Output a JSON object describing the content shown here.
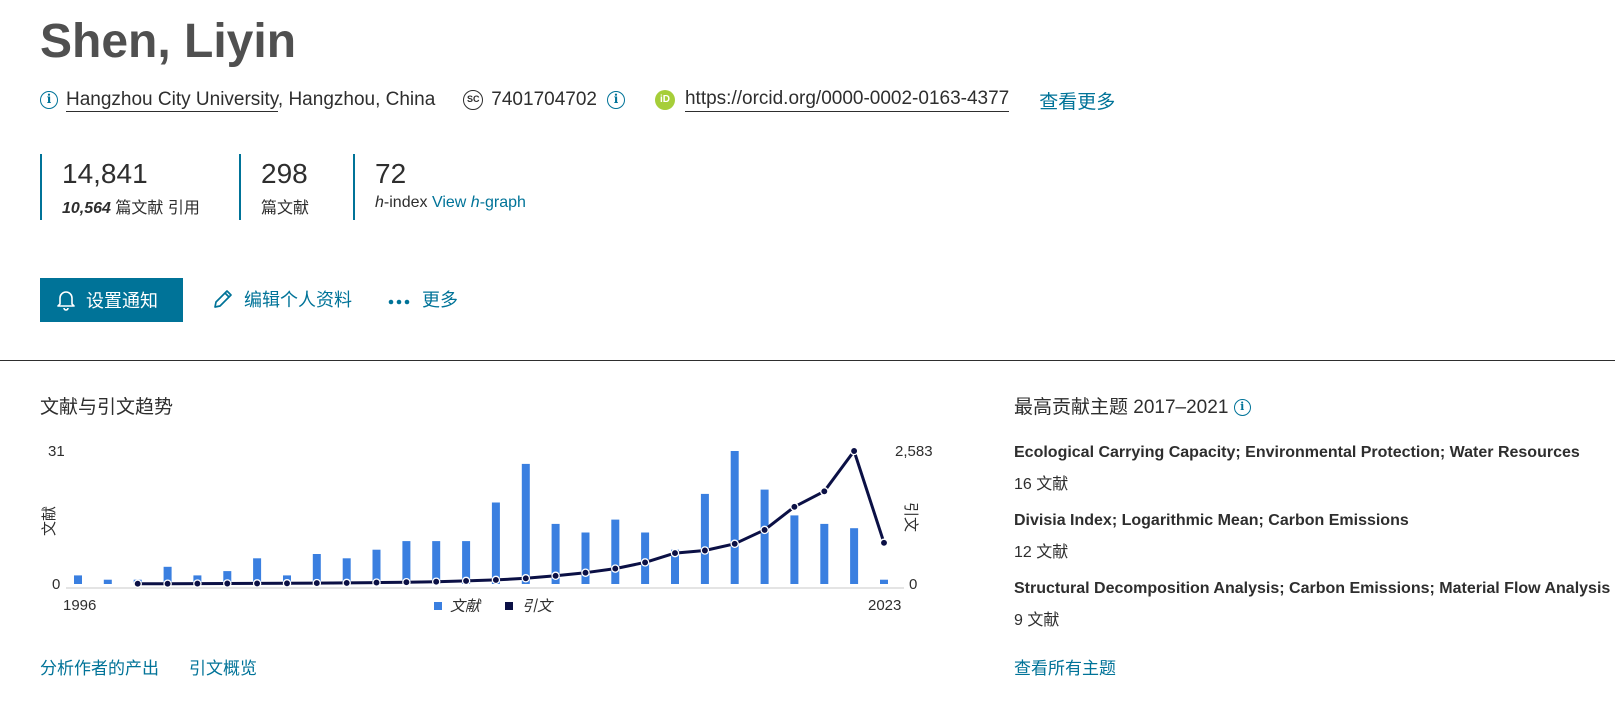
{
  "author": {
    "name": "Shen, Liyin",
    "affiliation_link": "Hangzhou City University",
    "affiliation_rest": ", Hangzhou, China",
    "scopus_id": "7401704702",
    "orcid_url": "https://orcid.org/0000-0002-0163-4377",
    "more_label": "查看更多"
  },
  "metrics": {
    "citations": {
      "value": "14,841",
      "docs_count": "10,564",
      "label_suffix": " 篇文献 引用"
    },
    "documents": {
      "value": "298",
      "label": "篇文献"
    },
    "h_index": {
      "value": "72",
      "h": "h",
      "label": "-index",
      "link_text": "View ",
      "link_h": "h",
      "link_rest": "-graph"
    }
  },
  "actions": {
    "set_alert": "设置通知",
    "edit_profile": "编辑个人资料",
    "more": "更多"
  },
  "trends": {
    "title": "文献与引文趋势",
    "left_axis_label": "文献",
    "right_axis_label": "引文",
    "left_max_label": "31",
    "left_min_label": "0",
    "right_max_label": "2,583",
    "right_min_label": "0",
    "start_year_label": "1996",
    "end_year_label": "2023",
    "legend_docs": "文献",
    "legend_cites": "引文",
    "analyze_link": "分析作者的产出",
    "citation_overview_link": "引文概览"
  },
  "topics": {
    "title": "最高贡献主题 2017–2021",
    "items": [
      {
        "name": "Ecological Carrying Capacity; Environmental Protection; Water Resources",
        "count": "16 文献"
      },
      {
        "name": "Divisia Index; Logarithmic Mean; Carbon Emissions",
        "count": "12 文献"
      },
      {
        "name": "Structural Decomposition Analysis; Carbon Emissions; Material Flow Analysis",
        "count": "9 文献"
      }
    ],
    "view_all": "查看所有主题"
  },
  "colors": {
    "accent": "#007398",
    "bar": "#3a7fe0",
    "line": "#0b1045",
    "orcid": "#a6ce39"
  },
  "chart_data": {
    "type": "bar",
    "years": [
      1996,
      1997,
      1998,
      1999,
      2000,
      2001,
      2002,
      2003,
      2004,
      2005,
      2006,
      2007,
      2008,
      2009,
      2010,
      2011,
      2012,
      2013,
      2014,
      2015,
      2016,
      2017,
      2018,
      2019,
      2020,
      2021,
      2022,
      2023
    ],
    "series": [
      {
        "name": "文献",
        "type": "bar",
        "axis": "left",
        "values": [
          2,
          1,
          1,
          4,
          2,
          3,
          6,
          2,
          7,
          6,
          8,
          10,
          10,
          10,
          19,
          28,
          14,
          12,
          15,
          12,
          8,
          21,
          31,
          22,
          16,
          14,
          13,
          1
        ]
      },
      {
        "name": "引文",
        "type": "line",
        "axis": "right",
        "values": [
          null,
          null,
          5,
          5,
          8,
          10,
          12,
          14,
          18,
          22,
          28,
          35,
          45,
          60,
          80,
          110,
          160,
          220,
          300,
          420,
          600,
          650,
          780,
          1050,
          1500,
          1800,
          2583,
          800
        ]
      }
    ],
    "ylim_left": [
      0,
      31
    ],
    "ylim_right": [
      0,
      2583
    ]
  }
}
